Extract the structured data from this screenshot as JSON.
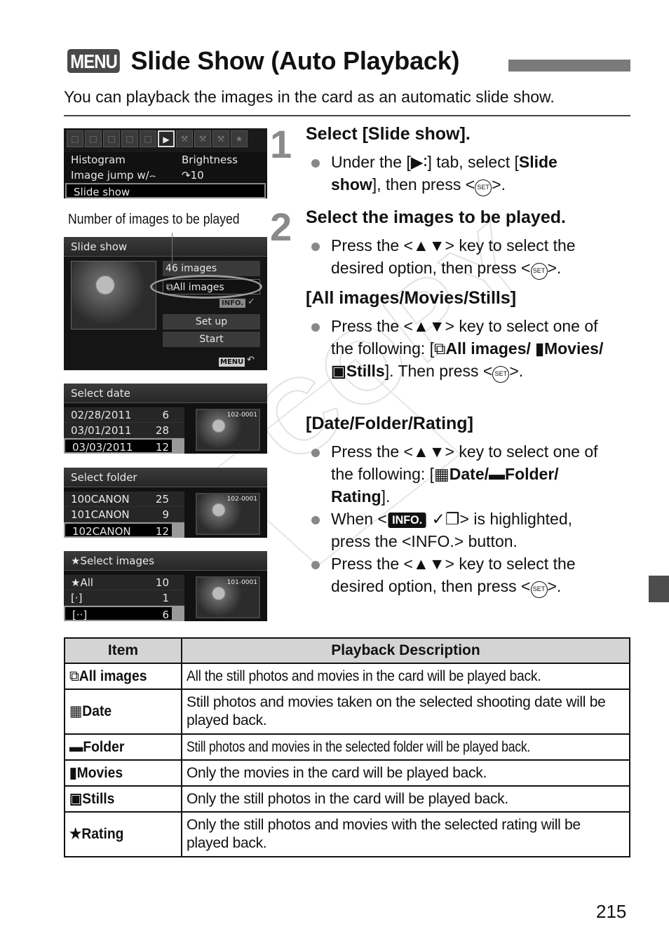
{
  "header": {
    "menu_badge": "MENU",
    "title": "Slide Show (Auto Playback)",
    "intro": "You can playback the images in the card as an automatic slide show."
  },
  "lcd_playback_menu": {
    "tabs": [
      "□",
      "□",
      "□",
      "□",
      "□",
      "▶",
      "⚒",
      "⚒",
      "⚒",
      "★"
    ],
    "active_tab_index": 5,
    "rows": [
      {
        "label": "Histogram",
        "value": "Brightness"
      },
      {
        "label": "Image jump w/⌢",
        "value": "↷10"
      },
      {
        "label": "Slide show",
        "value": ""
      }
    ],
    "selected_row": "Slide show"
  },
  "callout": "Number of images to be played",
  "lcd_slideshow": {
    "header": "Slide show",
    "count": "46 images",
    "selection": "⧉All images",
    "info_tag": "INFO.",
    "info_icon": "✓",
    "setup": "Set up",
    "start": "Start",
    "menu_tag": "MENU",
    "back_icon": "↶"
  },
  "lcd_select_date": {
    "header": "Select date",
    "items": [
      {
        "label": "02/28/2011",
        "count": "6"
      },
      {
        "label": "03/01/2011",
        "count": "28"
      },
      {
        "label": "03/03/2011",
        "count": "12"
      }
    ],
    "selected_index": 2,
    "thumb_file": "102-0001"
  },
  "lcd_select_folder": {
    "header": "Select folder",
    "items": [
      {
        "label": "100CANON",
        "count": "25"
      },
      {
        "label": "101CANON",
        "count": "9"
      },
      {
        "label": "102CANON",
        "count": "12"
      }
    ],
    "selected_index": 2,
    "thumb_file": "102-0001"
  },
  "lcd_select_images": {
    "header": "★Select images",
    "items": [
      {
        "label": "★All",
        "count": "10"
      },
      {
        "label": "[·]",
        "count": "1"
      },
      {
        "label": "[··]",
        "count": "6"
      }
    ],
    "selected_index": 2,
    "thumb_file": "101-0001"
  },
  "watermark": "COPY",
  "steps": [
    {
      "number": "1",
      "title": "Select [Slide show].",
      "bullets": [
        {
          "pre": "Under the [",
          "icon": "▶∶",
          "mid": "] tab, select [",
          "bold": "Slide show",
          "post": "], then press <",
          "set": "SET",
          "end": ">."
        }
      ]
    },
    {
      "number": "2",
      "title": "Select the images to be played.",
      "bullets": [
        {
          "pre": "Press the <",
          "keys": "▲▼",
          "post": "> key to select the desired option, then press <",
          "set": "SET",
          "end": ">."
        }
      ]
    }
  ],
  "section_all": {
    "title": "[All images/Movies/Stills]",
    "bullet": {
      "pre": "Press the <",
      "keys": "▲▼",
      "mid": "> key to select one of the following: [",
      "all_icon": "⧉",
      "all": "All images/",
      "movie_icon": "🎥",
      "movies": "Movies/",
      "still_icon": "📷",
      "stills": "Stills",
      "post": "]. Then press <",
      "set": "SET",
      "end": ">."
    }
  },
  "section_date": {
    "title": "[Date/Folder/Rating]",
    "bullets": [
      {
        "pre": "Press the <",
        "keys": "▲▼",
        "mid": "> key to select one of the following: [",
        "date_icon": "▦",
        "date": "Date/",
        "folder_icon": "▬",
        "folder": "Folder/",
        "rating": "Rating",
        "end": "]."
      },
      {
        "pre": "When <",
        "info": "INFO.",
        "info_icon": "✓❐",
        "mid": "> is highlighted, press the <INFO.> button."
      },
      {
        "pre": "Press the <",
        "keys": "▲▼",
        "post": "> key to select the desired option, then press <",
        "set": "SET",
        "end": ">."
      }
    ]
  },
  "table": {
    "headers": [
      "Item",
      "Playback Description"
    ],
    "rows": [
      {
        "icon": "⧉",
        "item": "All images",
        "desc": "All the still photos and movies in the card will be played back."
      },
      {
        "icon": "▦",
        "item": "Date",
        "desc": "Still photos and movies taken on the selected shooting date will be played back."
      },
      {
        "icon": "▬",
        "item": "Folder",
        "desc": "Still photos and movies in the selected folder will be played back."
      },
      {
        "icon": "▮",
        "item": "Movies",
        "desc": "Only the movies in the card will be played back."
      },
      {
        "icon": "▣",
        "item": "Stills",
        "desc": "Only the still photos in the card will be played back."
      },
      {
        "icon": "★",
        "item": "Rating",
        "desc": "Only the still photos and movies with the selected rating will be played back."
      }
    ]
  },
  "page_number": "215"
}
